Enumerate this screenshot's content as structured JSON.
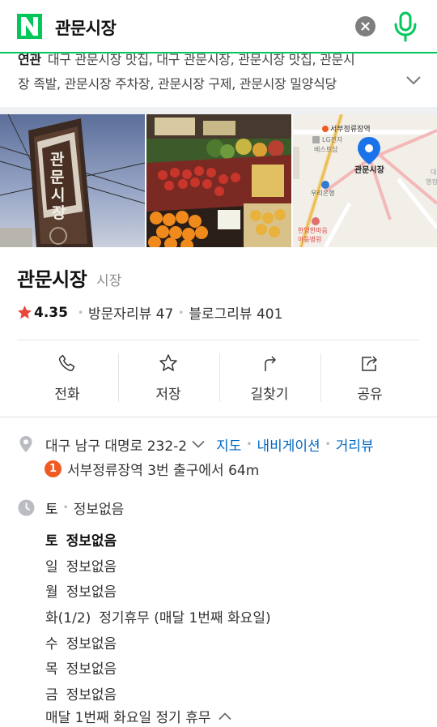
{
  "search": {
    "query": "관문시장",
    "logo_letter": "N",
    "brand_color": "#03c75a"
  },
  "related": {
    "title": "연관",
    "line1": "대구 관문시장 맛집, 대구 관문시장, 관문시장 맛집, 관문시",
    "line2": "장 족발, 관문시장 주차장, 관문시장 구제, 관문시장 밀양식당"
  },
  "photos": {
    "map_station_label": "서부정류장역",
    "map_lg_label": "LG전자",
    "map_lg_label2": "베스트샵",
    "map_place_label": "관문시장",
    "map_bank_label": "우리은행",
    "map_hospital_label": "한영한마음",
    "map_hospital_label2": "아동병원",
    "map_edge_label": "대",
    "map_edge_label2": "행정",
    "sign_text": "관문시장"
  },
  "place": {
    "name": "관문시장",
    "category": "시장",
    "rating": "4.35",
    "visitor_reviews": "방문자리뷰 47",
    "blog_reviews": "블로그리뷰 401",
    "rating_color": "#e8473a"
  },
  "actions": [
    {
      "label": "전화",
      "icon": "phone-icon"
    },
    {
      "label": "저장",
      "icon": "star-outline-icon"
    },
    {
      "label": "길찾기",
      "icon": "directions-icon"
    },
    {
      "label": "공유",
      "icon": "share-icon"
    }
  ],
  "address": {
    "text": "대구 남구 대명로 232-2",
    "map_link": "지도",
    "navigation_link": "내비게이션",
    "streetview_link": "거리뷰",
    "subway_line": "1",
    "subway_text": "서부정류장역 3번 출구에서 64m",
    "subway_color": "#f15a22",
    "link_color": "#0068c3"
  },
  "hours": {
    "today_day": "토",
    "today_status": "정보없음",
    "list": [
      {
        "day": "토",
        "status": "정보없음"
      },
      {
        "day": "일",
        "status": "정보없음"
      },
      {
        "day": "월",
        "status": "정보없음"
      },
      {
        "day": "화(1/2)",
        "status": "정기휴무 (매달 1번째 화요일)"
      },
      {
        "day": "수",
        "status": "정보없음"
      },
      {
        "day": "목",
        "status": "정보없음"
      },
      {
        "day": "금",
        "status": "정보없음"
      }
    ],
    "note": "매달 1번째 화요일 정기 휴무"
  }
}
